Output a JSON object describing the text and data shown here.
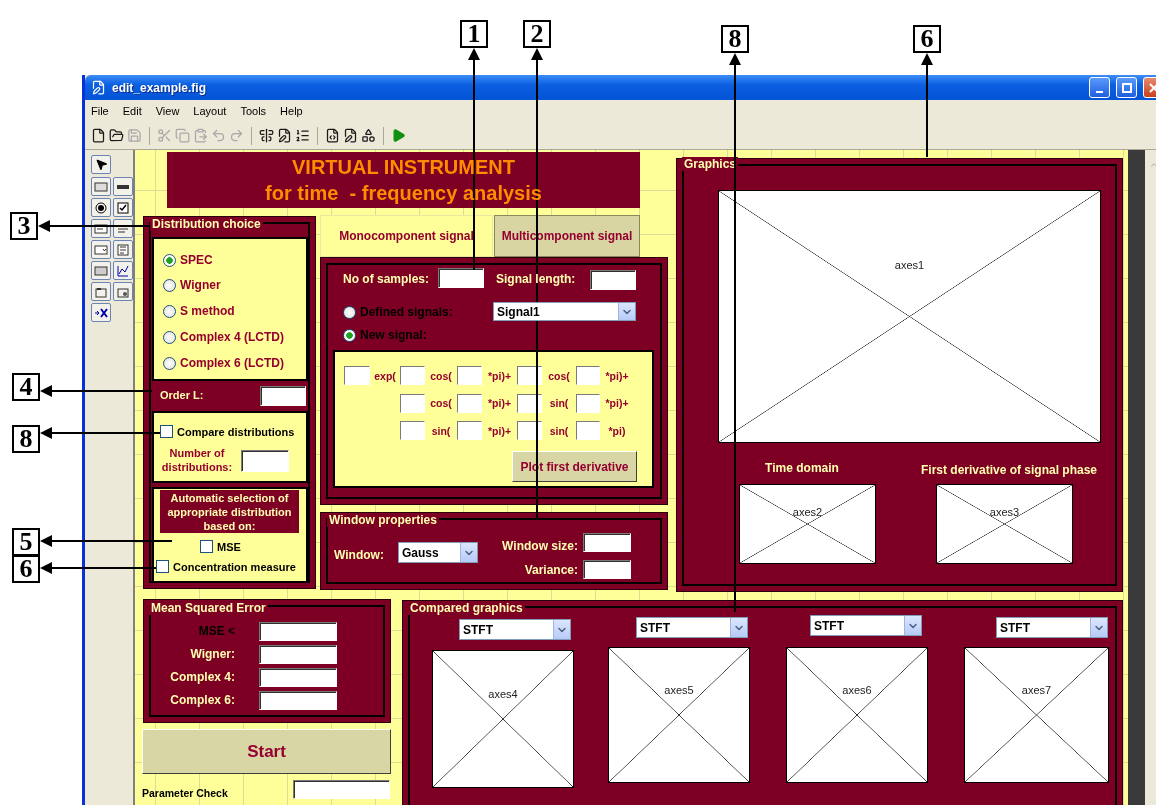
{
  "window": {
    "title": "edit_example.fig"
  },
  "menu": [
    "File",
    "Edit",
    "View",
    "Layout",
    "Tools",
    "Help"
  ],
  "toolbar": [
    {
      "disabled": false
    },
    {
      "disabled": false
    },
    {
      "disabled": true
    },
    {
      "disabled": true
    },
    {
      "disabled": true
    },
    {
      "disabled": true
    },
    {
      "disabled": true
    },
    {
      "disabled": true
    },
    {
      "disabled": false
    },
    {
      "disabled": false
    },
    {
      "disabled": false
    },
    {
      "disabled": false
    },
    {
      "disabled": false
    },
    {
      "disabled": false
    },
    {
      "disabled": false
    }
  ],
  "banner": {
    "lines": [
      "VIRTUAL INSTRUMENT",
      "for time  - frequency analysis"
    ]
  },
  "distribution_panel": {
    "title": "Distribution choice",
    "options": [
      {
        "label": "SPEC",
        "selected": true
      },
      {
        "label": "Wigner",
        "selected": false
      },
      {
        "label": "S method",
        "selected": false
      },
      {
        "label": "Complex 4 (LCTD)",
        "selected": false
      },
      {
        "label": "Complex 6 (LCTD)",
        "selected": false
      }
    ],
    "order_label": "Order L:",
    "compare": {
      "label": "Compare distributions",
      "checked": false
    },
    "number_label": "Number of distributions:",
    "auto_heading": "Automatic selection of appropriate distribution based on:",
    "criteria": [
      {
        "label": "MSE",
        "checked": false
      },
      {
        "label": "Concentration measure",
        "checked": false
      }
    ]
  },
  "tabs": [
    {
      "label": "Monocomponent signal",
      "selected": true
    },
    {
      "label": "Multicomponent signal",
      "selected": false
    }
  ],
  "signal_panel": {
    "samples_label": "No of samples:",
    "length_label": "Signal length:",
    "sources": [
      {
        "label": "Defined signals:",
        "selected": false
      },
      {
        "label": "New signal:",
        "selected": true
      }
    ],
    "signal_select": "Signal1",
    "equation": [
      [
        {
          "kind": "field"
        },
        {
          "kind": "text",
          "text": "exp("
        },
        {
          "kind": "field"
        },
        {
          "kind": "text",
          "text": "cos("
        },
        {
          "kind": "field"
        },
        {
          "kind": "text",
          "text": "*pi)+"
        },
        {
          "kind": "field"
        },
        {
          "kind": "text",
          "text": "cos("
        },
        {
          "kind": "field"
        },
        {
          "kind": "text",
          "text": "*pi)+"
        }
      ],
      [
        {
          "kind": "field"
        },
        {
          "kind": "text",
          "text": "cos("
        },
        {
          "kind": "field"
        },
        {
          "kind": "text",
          "text": "*pi)+"
        },
        {
          "kind": "field"
        },
        {
          "kind": "text",
          "text": "sin("
        },
        {
          "kind": "field"
        },
        {
          "kind": "text",
          "text": "*pi)+"
        }
      ],
      [
        {
          "kind": "field"
        },
        {
          "kind": "text",
          "text": "sin("
        },
        {
          "kind": "field"
        },
        {
          "kind": "text",
          "text": "*pi)+"
        },
        {
          "kind": "field"
        },
        {
          "kind": "text",
          "text": "sin("
        },
        {
          "kind": "field"
        },
        {
          "kind": "text",
          "text": "*pi)"
        }
      ]
    ],
    "derivative_button": "Plot first derivative"
  },
  "window_panel": {
    "title": "Window properties",
    "window_label": "Window:",
    "window_select": "Gauss",
    "size_label": "Window size:",
    "variance_label": "Variance:"
  },
  "graphics_panel": {
    "title": "Graphics",
    "main_axes": "axes1",
    "captions": [
      "Time domain",
      "First derivative of signal phase"
    ],
    "small_axes": [
      "axes2",
      "axes3"
    ]
  },
  "mse_panel": {
    "title": "Mean Squared Error",
    "rows": [
      {
        "label": "MSE <",
        "kind": "threshold"
      },
      {
        "label": "Wigner:",
        "kind": "method"
      },
      {
        "label": "Complex 4:",
        "kind": "method"
      },
      {
        "label": "Complex 6:",
        "kind": "method"
      }
    ]
  },
  "start_button": "Start",
  "parameter_check": "Parameter Check",
  "compared_panel": {
    "title": "Compared graphics",
    "plots": [
      {
        "method": "STFT",
        "axes": "axes4"
      },
      {
        "method": "STFT",
        "axes": "axes5"
      },
      {
        "method": "STFT",
        "axes": "axes6"
      },
      {
        "method": "STFT",
        "axes": "axes7"
      }
    ]
  },
  "callouts": [
    {
      "label": "1"
    },
    {
      "label": "2"
    },
    {
      "label": "8"
    },
    {
      "label": "6"
    },
    {
      "label": "3"
    },
    {
      "label": "4"
    },
    {
      "label": "8"
    },
    {
      "label": "5"
    },
    {
      "label": "6"
    }
  ]
}
